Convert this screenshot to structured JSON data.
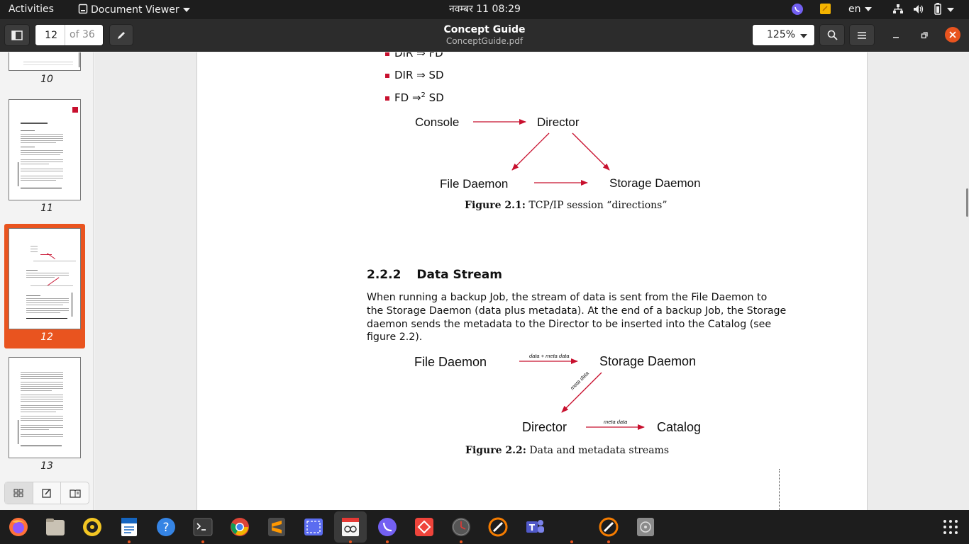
{
  "topbar": {
    "activities": "Activities",
    "app_name": "Document Viewer",
    "clock": "नवम्बर 11  08:29",
    "lang": "en"
  },
  "header": {
    "page_value": "12",
    "page_of": "of 36",
    "title": "Concept Guide",
    "filename": "ConceptGuide.pdf",
    "zoom": "125%"
  },
  "sidebar": {
    "thumbs": [
      {
        "label": "10"
      },
      {
        "label": "11"
      },
      {
        "label": "12"
      },
      {
        "label": "13"
      }
    ],
    "selected_page": "12"
  },
  "document": {
    "bullets": [
      "DIR ⇒ FD",
      "DIR ⇒ SD",
      "FD ⇒",
      "2",
      "SD"
    ],
    "fig1": {
      "nodes": [
        "Console",
        "Director",
        "File Daemon",
        "Storage Daemon"
      ],
      "caption_label": "Figure 2.1:",
      "caption_text": "TCP/IP session “directions”"
    },
    "section_number": "2.2.2",
    "section_title": "Data Stream",
    "paragraph_lines": [
      "When running a backup Job, the stream of data is sent from the File Daemon to",
      "the Storage Daemon (data plus metadata). At the end of a backup Job, the Storage",
      "daemon sends the metadata to the Director to be inserted into the Catalog (see",
      "figure 2.2)."
    ],
    "fig2": {
      "nodes": [
        "File Daemon",
        "Storage Daemon",
        "Director",
        "Catalog"
      ],
      "edge_labels": [
        "data + meta data",
        "meta data",
        "meta data"
      ],
      "caption_label": "Figure 2.2:",
      "caption_text": "Data and metadata streams"
    }
  },
  "colors": {
    "accent": "#e9541f",
    "arrow_red": "#c8102e",
    "topbar_bg": "#1d1d1d",
    "header_bg": "#2c2c2c"
  },
  "dock_apps": [
    "firefox-icon",
    "files-icon",
    "rhythmbox-icon",
    "writer-icon",
    "help-icon",
    "terminal-icon",
    "chrome-icon",
    "sublime-icon",
    "screenshot-icon",
    "document-viewer-icon",
    "viber-icon",
    "anydesk-icon",
    "clock-icon",
    "update-icon",
    "teams-icon",
    "blank-icon",
    "update2-icon",
    "disk-icon",
    "app-grid-icon"
  ]
}
